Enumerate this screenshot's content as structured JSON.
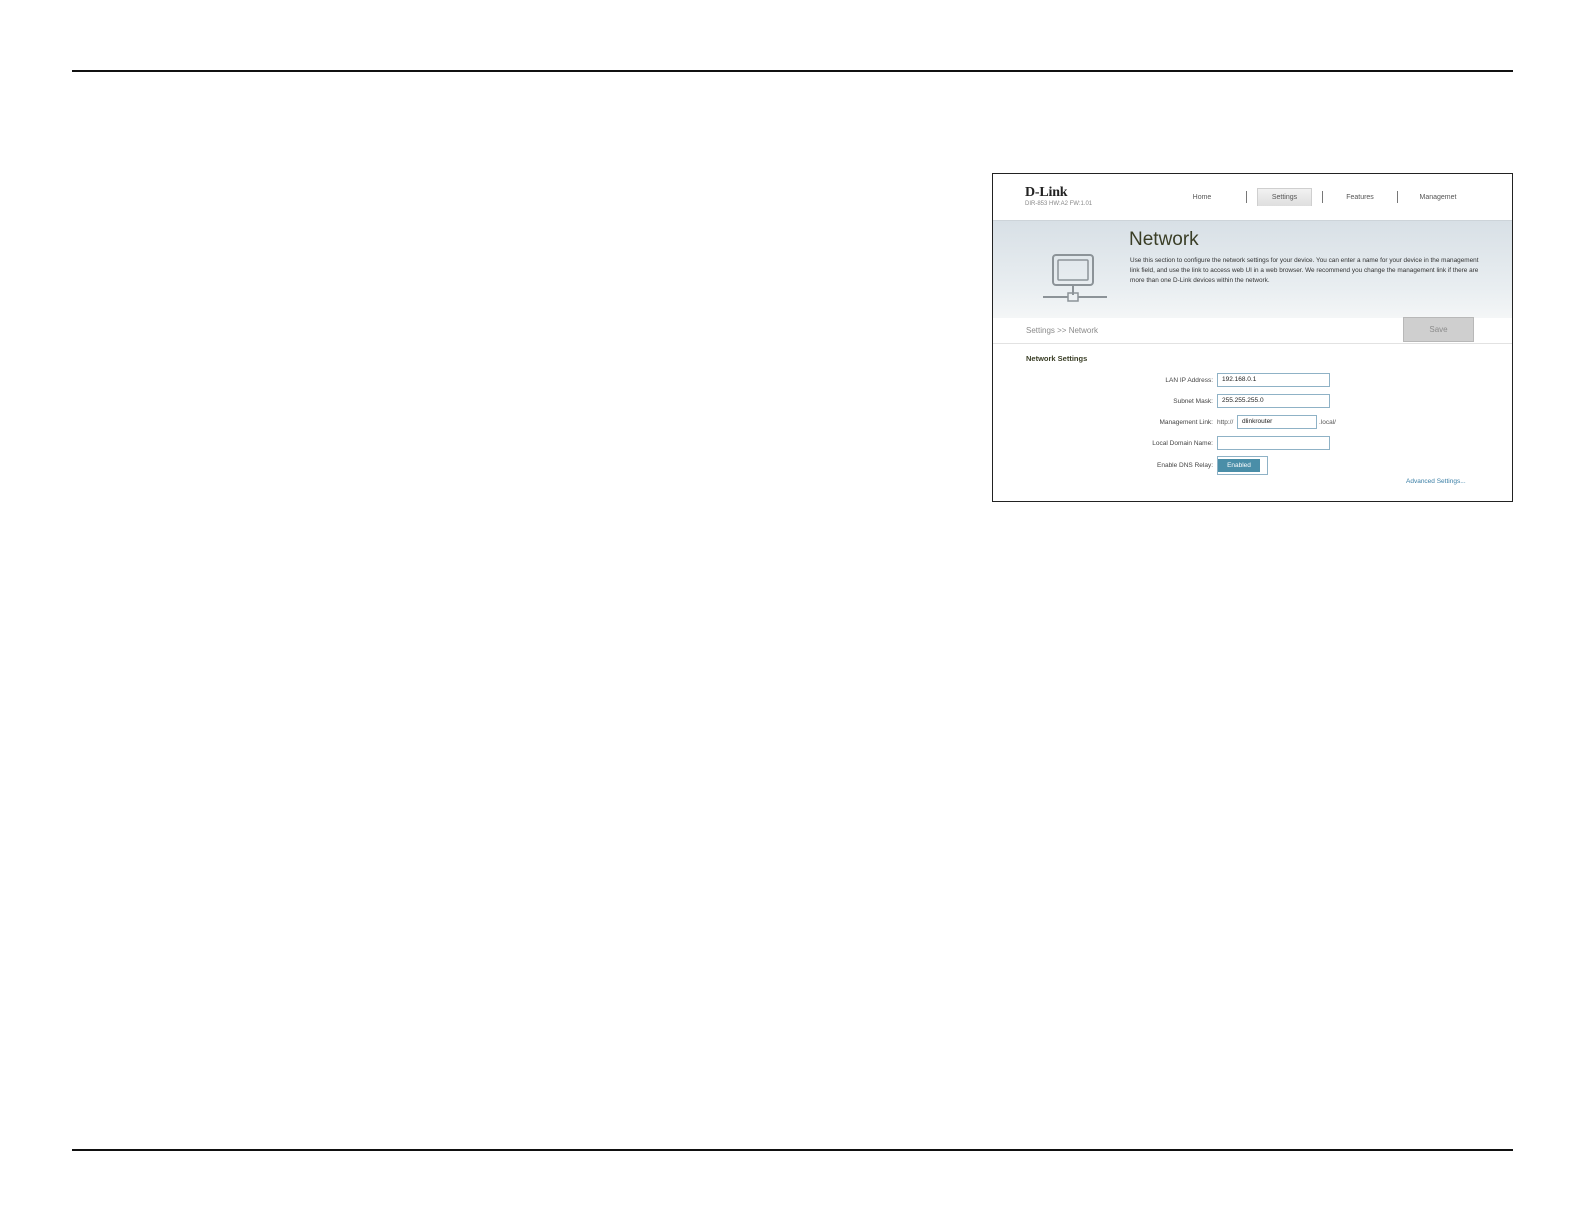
{
  "header": {
    "logo": "D-Link",
    "model": "DIR-853 HW:A2 FW:1.01",
    "nav": [
      "Home",
      "Settings",
      "Features",
      "Managemet"
    ],
    "active_tab": "Settings"
  },
  "hero": {
    "title": "Network",
    "description": "Use this section to configure the network settings for your device. You can enter a name for your device in the management link field, and use the link to access web UI in a web browser. We recommend you change the management link if there are more than one D-Link devices within the network."
  },
  "breadcrumb": "Settings >> Network",
  "save_label": "Save",
  "section_title": "Network Settings",
  "form": {
    "lan_ip_label": "LAN IP Address:",
    "lan_ip_value": "192.168.0.1",
    "subnet_label": "Subnet Mask:",
    "subnet_value": "255.255.255.0",
    "mgmt_label": "Management Link:",
    "mgmt_prefix": "http://",
    "mgmt_value": "dlinkrouter",
    "mgmt_suffix": ".local/",
    "domain_label": "Local Domain Name:",
    "domain_value": "",
    "dns_label": "Enable DNS Relay:",
    "dns_state": "Enabled"
  },
  "advanced_link": "Advanced Settings...",
  "colors": {
    "accent": "#4a8ea8",
    "link": "#3b7fa6",
    "title": "#3a3e26"
  }
}
